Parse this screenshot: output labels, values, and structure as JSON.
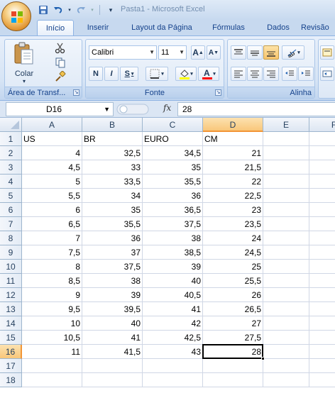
{
  "title": "Pasta1 - Microsoft Excel",
  "tabs": [
    {
      "label": "Início",
      "active": true
    },
    {
      "label": "Inserir",
      "active": false
    },
    {
      "label": "Layout da Página",
      "active": false
    },
    {
      "label": "Fórmulas",
      "active": false
    },
    {
      "label": "Dados",
      "active": false
    },
    {
      "label": "Revisão",
      "active": false
    }
  ],
  "ribbon": {
    "clipboard": {
      "paste_label": "Colar",
      "group_label": "Área de Transf...",
      "paste_icon": "paste-icon",
      "cut_icon": "scissors-icon",
      "copy_icon": "copy-icon",
      "format_painter_icon": "brush-icon"
    },
    "font": {
      "font_name": "Calibri",
      "font_size": "11",
      "bold": "N",
      "italic": "I",
      "underline": "S",
      "grow": "A",
      "shrink": "A",
      "group_label": "Fonte",
      "fill_color": "#ffff00",
      "font_color": "#ff0000"
    },
    "alignment": {
      "group_label": "Alinha"
    }
  },
  "formula_bar": {
    "name_box": "D16",
    "fx": "fx",
    "content": "28"
  },
  "sheet": {
    "columns": [
      "A",
      "B",
      "C",
      "D",
      "E",
      "F"
    ],
    "selected_column": "D",
    "selected_row": "16",
    "active_cell": "D16",
    "rows": [
      {
        "n": "1",
        "cells": [
          "US",
          "BR",
          "EURO",
          "CM",
          "",
          ""
        ]
      },
      {
        "n": "2",
        "cells": [
          "4",
          "32,5",
          "34,5",
          "21",
          "",
          ""
        ]
      },
      {
        "n": "3",
        "cells": [
          "4,5",
          "33",
          "35",
          "21,5",
          "",
          ""
        ]
      },
      {
        "n": "4",
        "cells": [
          "5",
          "33,5",
          "35,5",
          "22",
          "",
          ""
        ]
      },
      {
        "n": "5",
        "cells": [
          "5,5",
          "34",
          "36",
          "22,5",
          "",
          ""
        ]
      },
      {
        "n": "6",
        "cells": [
          "6",
          "35",
          "36,5",
          "23",
          "",
          ""
        ]
      },
      {
        "n": "7",
        "cells": [
          "6,5",
          "35,5",
          "37,5",
          "23,5",
          "",
          ""
        ]
      },
      {
        "n": "8",
        "cells": [
          "7",
          "36",
          "38",
          "24",
          "",
          ""
        ]
      },
      {
        "n": "9",
        "cells": [
          "7,5",
          "37",
          "38,5",
          "24,5",
          "",
          ""
        ]
      },
      {
        "n": "10",
        "cells": [
          "8",
          "37,5",
          "39",
          "25",
          "",
          ""
        ]
      },
      {
        "n": "11",
        "cells": [
          "8,5",
          "38",
          "40",
          "25,5",
          "",
          ""
        ]
      },
      {
        "n": "12",
        "cells": [
          "9",
          "39",
          "40,5",
          "26",
          "",
          ""
        ]
      },
      {
        "n": "13",
        "cells": [
          "9,5",
          "39,5",
          "41",
          "26,5",
          "",
          ""
        ]
      },
      {
        "n": "14",
        "cells": [
          "10",
          "40",
          "42",
          "27",
          "",
          ""
        ]
      },
      {
        "n": "15",
        "cells": [
          "10,5",
          "41",
          "42,5",
          "27,5",
          "",
          ""
        ]
      },
      {
        "n": "16",
        "cells": [
          "11",
          "41,5",
          "43",
          "28",
          "",
          ""
        ]
      },
      {
        "n": "17",
        "cells": [
          "",
          "",
          "",
          "",
          "",
          ""
        ]
      },
      {
        "n": "18",
        "cells": [
          "",
          "",
          "",
          "",
          "",
          ""
        ]
      }
    ]
  }
}
